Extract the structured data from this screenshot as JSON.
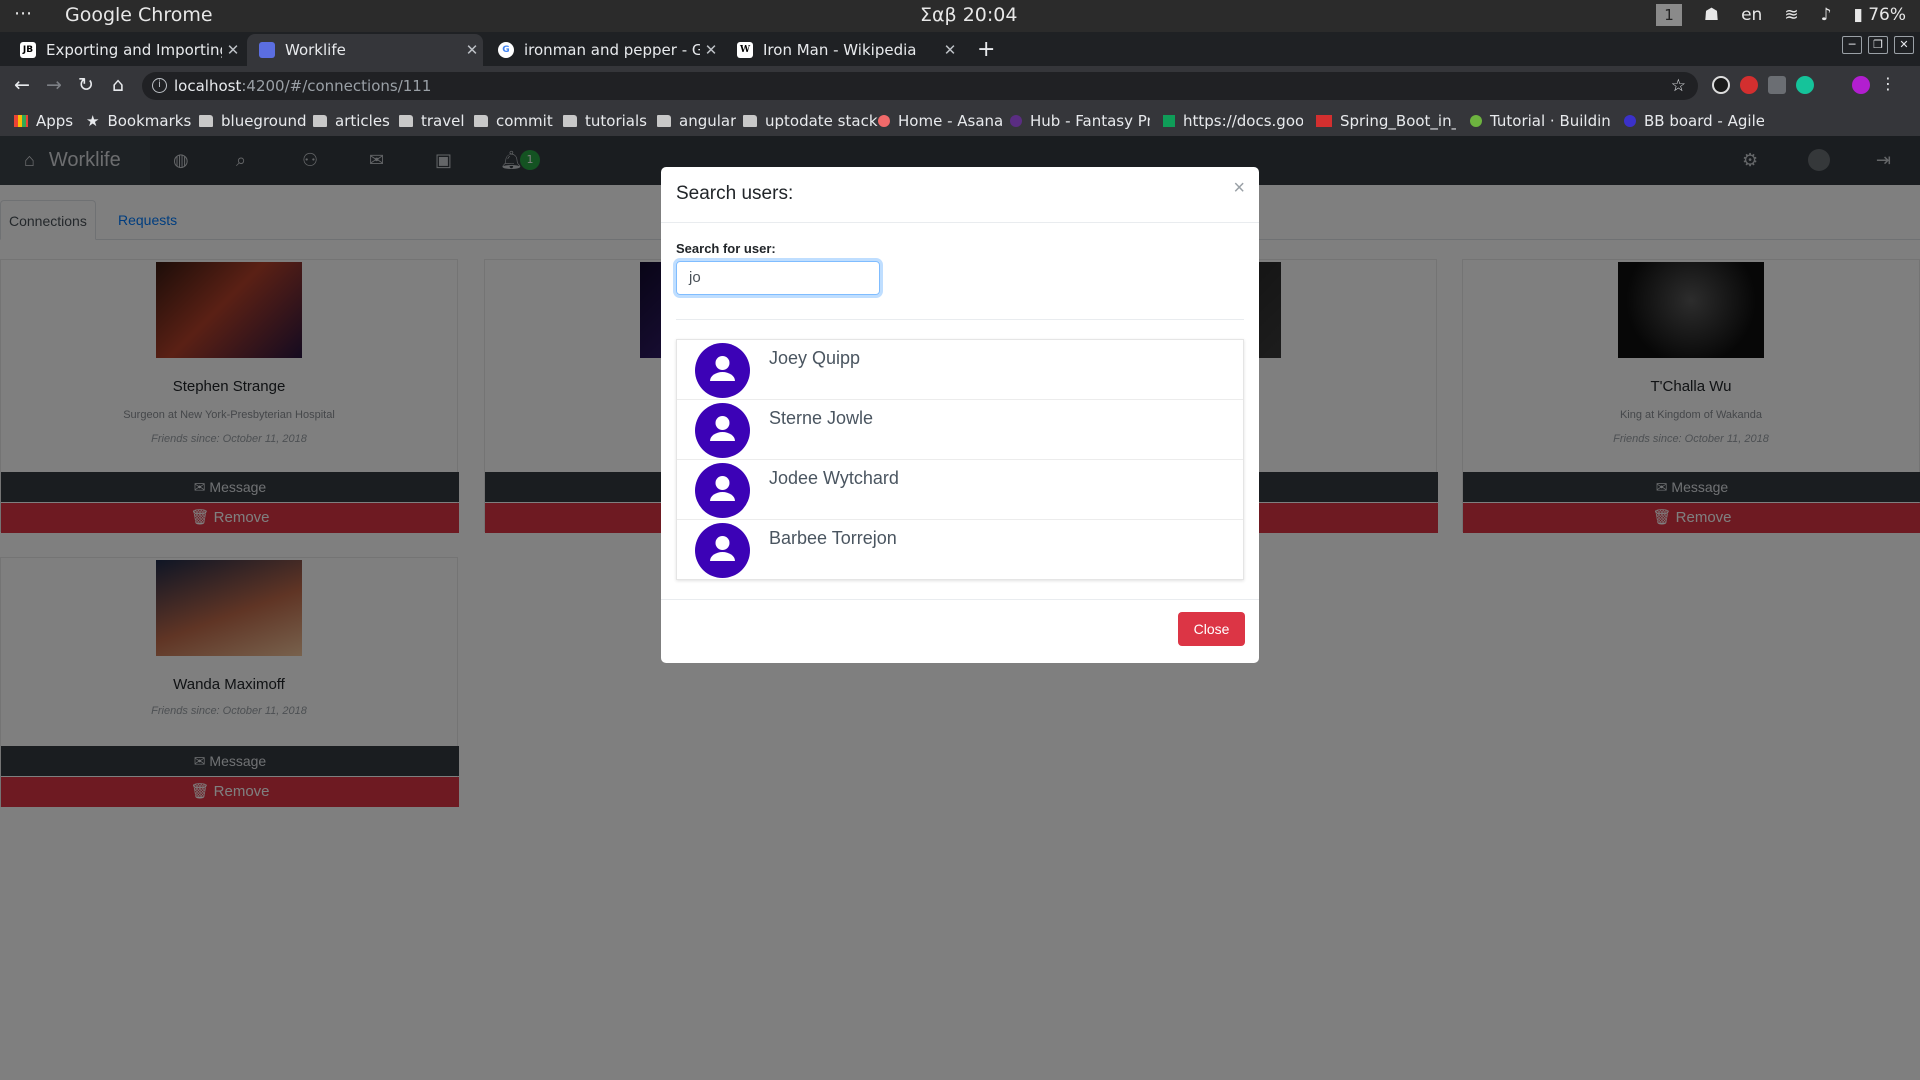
{
  "os": {
    "app_name": "Google Chrome",
    "clock": "Σαβ 20:04",
    "workspace": "1",
    "lang": "en",
    "battery": "76%"
  },
  "browser": {
    "tabs": [
      {
        "title": "Exporting and Importing Se",
        "favicon": "JB"
      },
      {
        "title": "Worklife",
        "favicon": ""
      },
      {
        "title": "ironman and pepper - Goo",
        "favicon": "G"
      },
      {
        "title": "Iron Man - Wikipedia",
        "favicon": "W"
      }
    ],
    "url_host": "localhost",
    "url_rest": ":4200/#/connections/111",
    "bookmarks": [
      "Apps",
      "Bookmarks",
      "blueground",
      "articles",
      "travel",
      "commit",
      "tutorials",
      "angular",
      "uptodate stack",
      "Home - Asana",
      "Hub - Fantasy Pr",
      "https://docs.goo",
      "Spring_Boot_in_/",
      "Tutorial · Building",
      "BB board - Agile"
    ]
  },
  "app": {
    "brand": "Worklife",
    "notification_count": "1",
    "tabs": [
      "Connections",
      "Requests"
    ],
    "connections": [
      {
        "name": "Stephen Strange",
        "job": "Surgeon at New York-Presbyterian Hospital",
        "since": "Friends since: October 11, 2018"
      },
      {
        "name": "T'Challa Wu",
        "job": "King at Kingdom of Wakanda",
        "since": "Friends since: October 11, 2018"
      },
      {
        "name": "Wanda Maximoff",
        "job": "",
        "since": "Friends since: October 11, 2018"
      }
    ],
    "message_label": "Message",
    "remove_label": "Remove"
  },
  "modal": {
    "title": "Search users:",
    "close_symbol": "×",
    "label": "Search for user:",
    "query": "jo",
    "results": [
      "Joey Quipp",
      "Sterne Jowle",
      "Jodee Wytchard",
      "Barbee Torrejon"
    ],
    "close_button": "Close"
  },
  "colors": {
    "avatar": "#3c02b6",
    "danger": "#dc3545",
    "navbar": "#343a40",
    "badge": "#28a745"
  }
}
